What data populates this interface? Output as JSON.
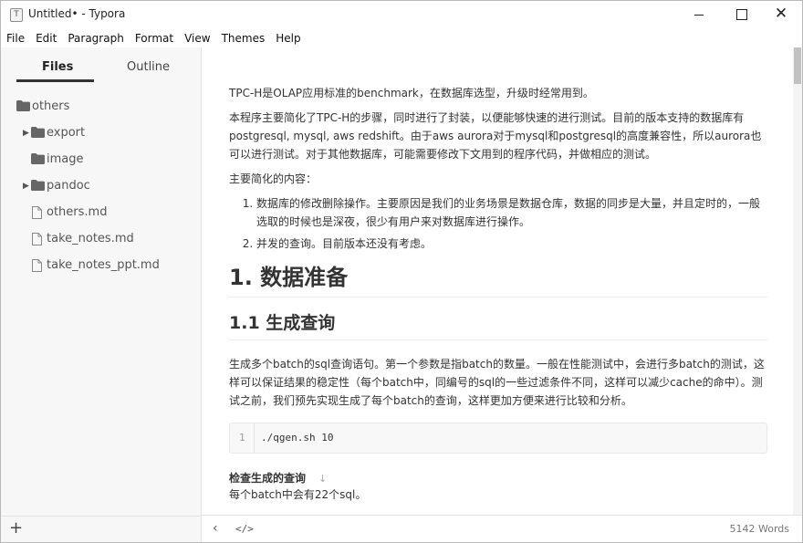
{
  "window": {
    "icon_letter": "T",
    "title": "Untitled• - Typora",
    "minimize_glyph": "",
    "maximize_glyph": "",
    "close_glyph": "✕"
  },
  "menu": [
    "File",
    "Edit",
    "Paragraph",
    "Format",
    "View",
    "Themes",
    "Help"
  ],
  "sidebar": {
    "tabs": {
      "files": "Files",
      "outline": "Outline"
    },
    "tree": [
      {
        "label": "others",
        "type": "folder",
        "expanded": true
      },
      {
        "label": "export",
        "type": "folder",
        "collapsed": true
      },
      {
        "label": "image",
        "type": "folder"
      },
      {
        "label": "pandoc",
        "type": "folder",
        "collapsed": true
      },
      {
        "label": "others.md",
        "type": "file"
      },
      {
        "label": "take_notes.md",
        "type": "file"
      },
      {
        "label": "take_notes_ppt.md",
        "type": "file"
      }
    ],
    "add_glyph": "+"
  },
  "document": {
    "p1": "TPC-H是OLAP应用标准的benchmark，在数据库选型，升级时经常用到。",
    "p2": "本程序主要简化了TPC-H的步骤，同时进行了封装，以便能够快速的进行测试。目前的版本支持的数据库有postgresql, mysql, aws redshift。由于aws aurora对于mysql和postgresql的高度兼容性，所以aurora也可以进行测试。对于其他数据库，可能需要修改下文用到的程序代码，并做相应的测试。",
    "p3": "主要简化的内容：",
    "list": [
      "数据库的修改删除操作。主要原因是我们的业务场景是数据仓库，数据的同步是大量，并且定时的，一般选取的时候也是深夜，很少有用户来对数据库进行操作。",
      "并发的查询。目前版本还没有考虑。"
    ],
    "h1": "1. 数据准备",
    "h2": "1.1 生成查询",
    "p4": "生成多个batch的sql查询语句。第一个参数是指batch的数量。一般在性能测试中，会进行多batch的测试，这样可以保证结果的稳定性（每个batch中，同编号的sql的一些过滤条件不同，这样可以减少cache的命中）。测试之前，我们预先实现生成了每个batch的查询，这样更加方便来进行比较和分析。",
    "code": {
      "line_number": "1",
      "text": "./qgen.sh 10"
    },
    "h4": "检查生成的查询",
    "h4_arrow": "↓",
    "p5": "每个batch中会有22个sql。"
  },
  "statusbar": {
    "back_glyph": "‹",
    "source_glyph": "</>",
    "word_count": "5142 Words"
  },
  "colors": {
    "sidebar_bg": "#f7f7f7",
    "text": "#333333",
    "code_bg": "#f8f8f8"
  }
}
